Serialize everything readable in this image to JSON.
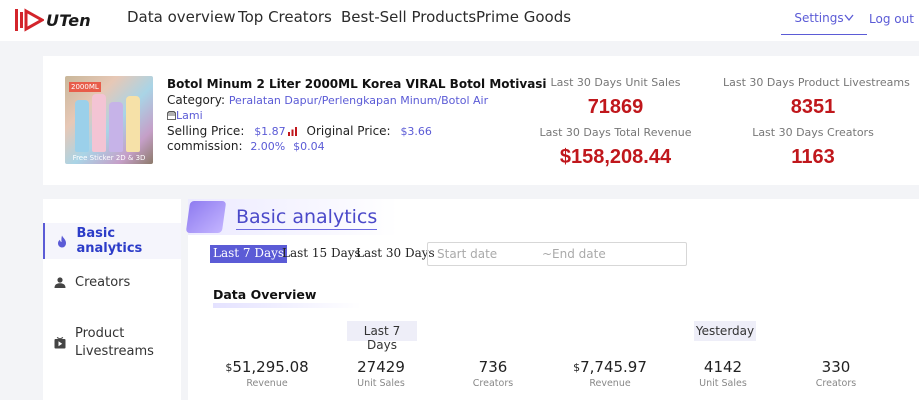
{
  "brand": {
    "name": "UTen",
    "colors": {
      "accent": "#5b5bd6",
      "highlight": "#c0171c",
      "logo_red": "#d3242b"
    }
  },
  "nav": {
    "items": [
      "Data overview",
      "Top Creators",
      "Best-Sell Products",
      "Prime Goods"
    ],
    "settings_label": "Settings",
    "logout_label": "Log out"
  },
  "product": {
    "title": "Botol Minum 2 Liter 2000ML Korea VIRAL Botol Motivasi",
    "category_label": "Category:",
    "category_value": "Peralatan Dapur/Perlengkapan Minum/Botol Air",
    "shop": "Lami",
    "selling_price_label": "Selling Price:",
    "selling_price": "$1.87",
    "original_price_label": "Original Price:",
    "original_price": "$3.66",
    "commission_label": "commission:",
    "commission_rate": "2.00%",
    "commission_value": "$0.04",
    "thumb_caption": "Free Sticker 2D & 3D",
    "thumb_badge": "2000ML"
  },
  "stats": [
    {
      "label": "Last 30 Days Unit Sales",
      "value": "71869"
    },
    {
      "label": "Last 30 Days Product Livestreams",
      "value": "8351"
    },
    {
      "label": "Last 30 Days Total Revenue",
      "value": "$158,208.44"
    },
    {
      "label": "Last 30 Days Creators",
      "value": "1163"
    }
  ],
  "sidebar": {
    "items": [
      {
        "label": "Basic analytics",
        "icon": "flame-icon",
        "active": true
      },
      {
        "label": "Creators",
        "icon": "person-icon",
        "active": false
      },
      {
        "label": "Product Livestreams",
        "icon": "video-icon",
        "active": false
      }
    ]
  },
  "main": {
    "title": "Basic analytics",
    "ranges": [
      "Last 7 Days",
      "Last 15 Days",
      "Last 30 Days"
    ],
    "active_range": "Last 7 Days",
    "date_start_placeholder": "Start date",
    "date_end_placeholder": "~End date",
    "overview_title": "Data Overview",
    "periods": [
      {
        "label": "Last 7 Days",
        "metrics": [
          {
            "currency": "$",
            "value": "51,295.08",
            "label": "Revenue"
          },
          {
            "currency": "",
            "value": "27429",
            "label": "Unit Sales"
          },
          {
            "currency": "",
            "value": "736",
            "label": "Creators"
          }
        ]
      },
      {
        "label": "Yesterday",
        "metrics": [
          {
            "currency": "$",
            "value": "7,745.97",
            "label": "Revenue"
          },
          {
            "currency": "",
            "value": "4142",
            "label": "Unit Sales"
          },
          {
            "currency": "",
            "value": "330",
            "label": "Creators"
          }
        ]
      }
    ]
  }
}
